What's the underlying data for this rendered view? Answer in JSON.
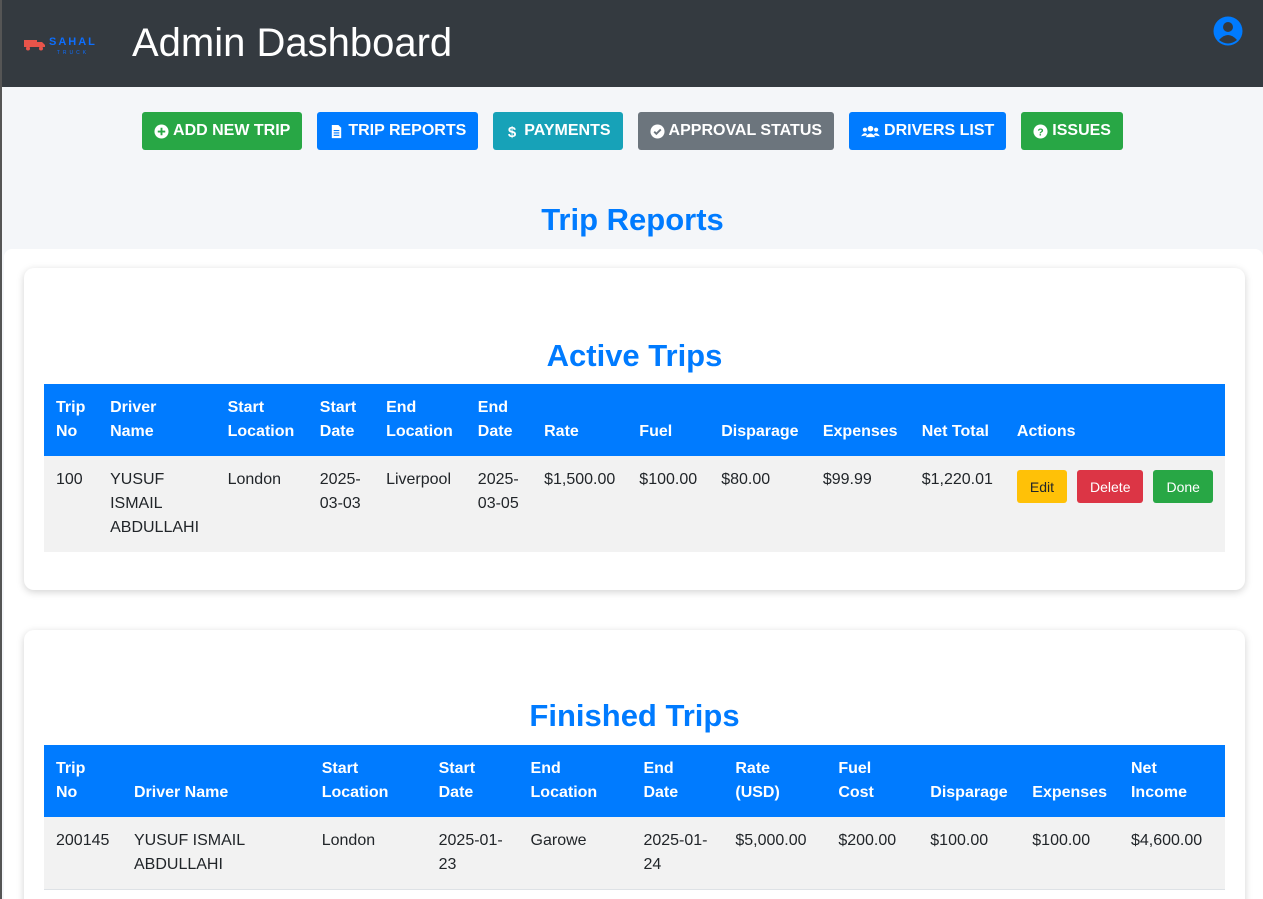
{
  "header": {
    "logo_text": "SAHAL",
    "logo_sub": "TRUCK",
    "title": "Admin Dashboard"
  },
  "nav": [
    {
      "label": "ADD NEW TRIP",
      "icon": "plus-circle-icon",
      "color": "#28a745"
    },
    {
      "label": "TRIP REPORTS",
      "icon": "file-icon",
      "color": "#007bff"
    },
    {
      "label": "PAYMENTS",
      "icon": "dollar-icon",
      "color": "#17a2b8"
    },
    {
      "label": "APPROVAL STATUS",
      "icon": "check-circle-icon",
      "color": "#6c757d"
    },
    {
      "label": "DRIVERS LIST",
      "icon": "users-icon",
      "color": "#007bff"
    },
    {
      "label": "ISSUES",
      "icon": "question-circle-icon",
      "color": "#28a745"
    }
  ],
  "page_title": "Trip Reports",
  "active": {
    "title": "Active Trips",
    "columns": [
      "Trip No",
      "Driver Name",
      "Start Location",
      "Start Date",
      "End Location",
      "End Date",
      "Rate",
      "Fuel",
      "Disparage",
      "Expenses",
      "Net Total",
      "Actions"
    ],
    "rows": [
      {
        "trip_no": "100",
        "driver": "YUSUF ISMAIL ABDULLAHI",
        "start_location": "London",
        "start_date": "2025-03-03",
        "end_location": "Liverpool",
        "end_date": "2025-03-05",
        "rate": "$1,500.00",
        "fuel": "$100.00",
        "disparage": "$80.00",
        "expenses": "$99.99",
        "net_total": "$1,220.01",
        "edit_label": "Edit",
        "delete_label": "Delete",
        "done_label": "Done"
      }
    ]
  },
  "finished": {
    "title": "Finished Trips",
    "columns": [
      "Trip No",
      "Driver Name",
      "Start Location",
      "Start Date",
      "End Location",
      "End Date",
      "Rate (USD)",
      "Fuel Cost",
      "Disparage",
      "Expenses",
      "Net Income"
    ],
    "rows": [
      {
        "trip_no": "200145",
        "driver": "YUSUF ISMAIL ABDULLAHI",
        "start_location": "London",
        "start_date": "2025-01-23",
        "end_location": "Garowe",
        "end_date": "2025-01-24",
        "rate": "$5,000.00",
        "fuel": "$200.00",
        "disparage": "$100.00",
        "expenses": "$100.00",
        "net_income": "$4,600.00"
      }
    ]
  }
}
